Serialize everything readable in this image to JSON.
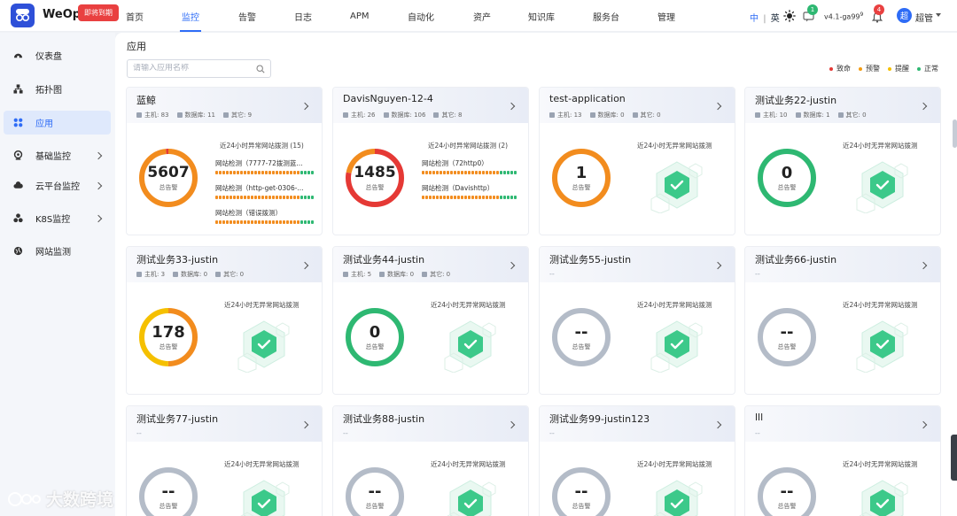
{
  "header": {
    "brand": "WeOps",
    "expire_badge": "即将到期",
    "menu": [
      {
        "label": "首页",
        "active": false
      },
      {
        "label": "监控",
        "active": true
      },
      {
        "label": "告警",
        "active": false
      },
      {
        "label": "日志",
        "active": false
      },
      {
        "label": "APM",
        "active": false
      },
      {
        "label": "自动化",
        "active": false
      },
      {
        "label": "资产",
        "active": false
      },
      {
        "label": "知识库",
        "active": false
      },
      {
        "label": "服务台",
        "active": false
      },
      {
        "label": "管理",
        "active": false
      }
    ],
    "lang_zh": "中",
    "lang_sep": "|",
    "lang_en": "英",
    "msg_count": "1",
    "version": "v4.1-ga99",
    "version_sup": "9",
    "bell_count": "4",
    "avatar_char": "超",
    "user_name": "超管"
  },
  "sidebar": {
    "items": [
      {
        "label": "仪表盘",
        "icon": "dashboard-icon",
        "active": false,
        "expandable": false
      },
      {
        "label": "拓扑图",
        "icon": "topology-icon",
        "active": false,
        "expandable": false
      },
      {
        "label": "应用",
        "icon": "app-icon",
        "active": true,
        "expandable": false
      },
      {
        "label": "基础监控",
        "icon": "basic-monitor-icon",
        "active": false,
        "expandable": true
      },
      {
        "label": "云平台监控",
        "icon": "cloud-icon",
        "active": false,
        "expandable": true
      },
      {
        "label": "K8S监控",
        "icon": "k8s-icon",
        "active": false,
        "expandable": true
      },
      {
        "label": "网站监测",
        "icon": "website-icon",
        "active": false,
        "expandable": false
      }
    ]
  },
  "main": {
    "title": "应用",
    "search_placeholder": "请输入应用名称",
    "legend": [
      {
        "label": "致命",
        "color": "#e53935"
      },
      {
        "label": "预警",
        "color": "#f39c12"
      },
      {
        "label": "提醒",
        "color": "#f5c000"
      },
      {
        "label": "正常",
        "color": "#2eb872"
      }
    ],
    "ring_label": "总告警",
    "no_probe_text": "近24小时无异常网站拨测",
    "cards": [
      {
        "title": "蓝鲸",
        "has_stats": true,
        "stats": [
          "主机: 83",
          "数据库: 11",
          "其它: 9"
        ],
        "count": "5607",
        "ring": "orange-red",
        "probe_title": "近24小时异常网站拨测 (15)",
        "probes": [
          "网站检测（7777-72拨测蓝...",
          "网站检测（http-get-0306-...",
          "网站检测（错误拨测）"
        ]
      },
      {
        "title": "DavisNguyen-12-4",
        "has_stats": true,
        "stats": [
          "主机: 26",
          "数据库: 106",
          "其它: 8"
        ],
        "count": "1485",
        "ring": "red-orange",
        "probe_title": "近24小时异常网站拨测 (2)",
        "probes": [
          "网站检测（72http0）",
          "网站检测（Davishttp）"
        ]
      },
      {
        "title": "test-application",
        "has_stats": true,
        "stats": [
          "主机: 13",
          "数据库: 0",
          "其它: 0"
        ],
        "count": "1",
        "ring": "orange"
      },
      {
        "title": "测试业务22-justin",
        "has_stats": true,
        "stats": [
          "主机: 10",
          "数据库: 1",
          "其它: 0"
        ],
        "count": "0",
        "ring": "green"
      },
      {
        "title": "测试业务33-justin",
        "has_stats": true,
        "stats": [
          "主机: 3",
          "数据库: 0",
          "其它: 0"
        ],
        "count": "178",
        "ring": "orange-yellow"
      },
      {
        "title": "测试业务44-justin",
        "has_stats": true,
        "stats": [
          "主机: 5",
          "数据库: 0",
          "其它: 0"
        ],
        "count": "0",
        "ring": "green"
      },
      {
        "title": "测试业务55-justin",
        "has_stats": false,
        "dash": "--",
        "count": "--",
        "ring": "gray"
      },
      {
        "title": "测试业务66-justin",
        "has_stats": false,
        "dash": "--",
        "count": "--",
        "ring": "gray"
      },
      {
        "title": "测试业务77-justin",
        "has_stats": false,
        "dash": "--",
        "count": "--",
        "ring": "gray"
      },
      {
        "title": "测试业务88-justin",
        "has_stats": false,
        "dash": "--",
        "count": "--",
        "ring": "gray"
      },
      {
        "title": "测试业务99-justin123",
        "has_stats": false,
        "dash": "--",
        "count": "--",
        "ring": "gray"
      },
      {
        "title": "lll",
        "has_stats": false,
        "dash": "--",
        "count": "--",
        "ring": "gray"
      }
    ]
  },
  "watermark": "大数跨境"
}
